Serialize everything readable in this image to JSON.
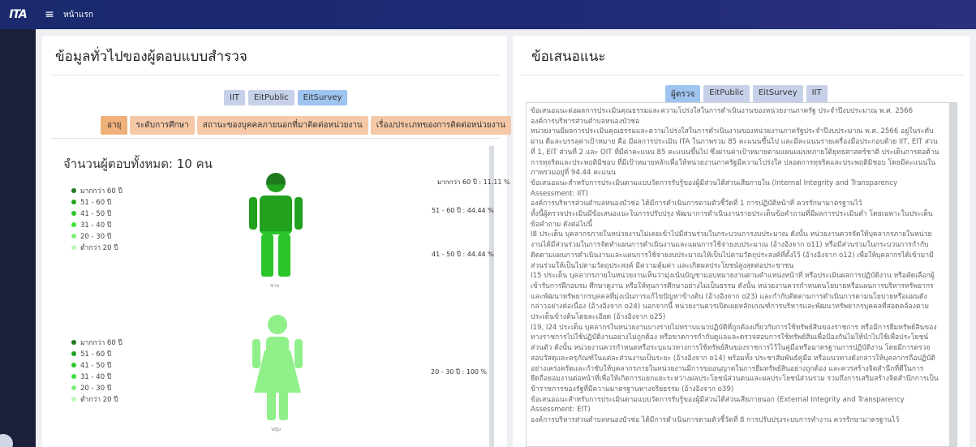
{
  "topbar": {
    "logo": "ITA",
    "menu_icon": "hamburger-icon",
    "breadcrumb": "หน้าแรก"
  },
  "left": {
    "title": "ข้อมูลทั่วไปของผู้ตอบแบบสำรวจ",
    "survey_tabs": [
      "IIT",
      "EitPublic",
      "EitSurvey"
    ],
    "active_survey_tab": "EitSurvey",
    "filter_tabs": [
      "อายุ",
      "ระดับการศึกษา",
      "สถานะของบุคคลภายนอกที่มาติดต่อหน่วยงาน",
      "เรื่อง/ประเภทของการติดต่อหน่วยงาน"
    ],
    "active_filter_tab": "อายุ",
    "total_label": "จำนวนผู้ตอบทั้งหมด: 10 คน",
    "age_legend": [
      "มากกว่า 60 ปี",
      "51 - 60 ปี",
      "41 - 50 ปี",
      "31 - 40 ปี",
      "20 - 30 ปี",
      "ต่ำกว่า 20 ปี"
    ],
    "legend_colors": [
      "#1f7a1f",
      "#22a11e",
      "#2bc52b",
      "#3ee13a",
      "#7ef07a",
      "#bff7bb"
    ],
    "male": {
      "caption": "ชาย",
      "labels": [
        "มากกว่า 60 ปี : 11.11 %",
        "51 - 60 ปี : 44.44 %",
        "41 - 50 ปี : 44.44 %"
      ],
      "shares": [
        11.11,
        44.44,
        44.44
      ]
    },
    "female": {
      "caption": "หญิง",
      "labels": [
        "20 - 30 ปี : 100 %"
      ],
      "shares": [
        100
      ]
    }
  },
  "right": {
    "title": "ข้อเสนอแนะ",
    "tabs": [
      "ผู้ตรวจ",
      "EitPublic",
      "EitSurvey",
      "IIT"
    ],
    "active_tab": "ผู้ตรวจ",
    "paragraphs": [
      "ข้อเสนอแนะต่อผลการประเมินคุณธรรมและความโปร่งใสในการดำเนินงานของหน่วยงานภาครัฐ ประจำปีงบประมาณ พ.ศ. 2566",
      "องค์การบริหารส่วนตำบลหนองบัวช่อ",
      "หน่วยงานมีผลการประเมินคุณธรรมและความโปร่งใสในการดำเนินงานของหน่วยงานภาครัฐประจำปีงบประมาณ พ.ศ. 2566 อยู่ในระดับผ่าน ดีและบรรลุค่าเป้าหมาย คือ มีผลการประเมิน ITA ในภาพรวม 85 คะแนนขึ้นไป และมีคะแนนรายเครื่องมือประกอบด้วย IIT, EIT ส่วนที่ 1, EIT ส่วนที่ 2 และ OIT ที่มีค่าคะแนน 85 คะแนนขึ้นไป ซึ่งผ่านค่าเป้าหมายตามแผนแม่บทภายใต้ยุทธศาสตร์ชาติ ประเด็นการต่อต้านการทุจริตและประพฤติมิชอบ ที่มีเป้าหมายหลักเพื่อให้หน่วยงานภาครัฐมีความโปร่งใส ปลอดการทุจริตและประพฤติมิชอบ โดยมีคะแนนในภาพรวมอยู่ที่ 94.44 คะแนน",
      "ข้อเสนอแนะสำหรับการประเมินตามแบบวัดการรับรู้ของผู้มีส่วนได้ส่วนเสียภายใน (Internal Integrity and Transparency Assessment: IIT)",
      "องค์การบริหารส่วนตำบลหนองบัวช่อ ได้มีการดำเนินการตามตัวชี้วัดที่ 1 การปฏิบัติหน้าที่ ควรรักษามาตรฐานไว้",
      "ทั้งนี้ผู้ตรวจประเมินมีข้อเสนอแนะในการปรับปรุง พัฒนาการดำเนินงานรายประเด็นข้อคำถามที่มีผลการประเมินต่ำ โดยเฉพาะในประเด็นข้อคำถาม ดังต่อไปนี้",
      "I8 ประเด็น บุคลากรภายในหน่วยงานไม่เคยเข้าไปมีส่วนร่วมในกระบวนการงบประมาณ ดังนั้น หน่วยงานควรจัดให้บุคลากรภายในหน่วยงานได้มีส่วนร่วมในการจัดทำแผนการดำเนินงานและแผนการใช้จ่ายงบประมาณ (อ้างอิงจาก o11) หรือมีส่วนร่วมในกระบวนการกำกับติดตามแผนการดำเนินงานและแผนการใช้จ่ายงบประมาณให้เป็นไปตามวัตถุประสงค์ที่ตั้งไว้ (อ้างอิงจาก o12) เพื่อให้บุคลากรได้เข้ามามีส่วนร่วมให้เป็นไปตามวัตถุประสงค์ มีความคุ้มค่า และเกิดผลประโยชน์สูงสุดต่อประชาชน",
      "I15 ประเด็น บุคลากรภายในหน่วยงานเห็นว่ามุ่งเน้นบัญชามอบหมายงานตามตำแหน่งหน้าที่ หรือประเมินผลการปฏิบัติงาน หรือคัดเลือกผู้เข้ารับการฝึกอบรม ศึกษาดูงาน หรือให้ทุนการศึกษาอย่างไม่เป็นธรรม ดังนั้น หน่วยงานควรกำหนดนโยบายหรือแผนการบริหารทรัพยากรและพัฒนาทรัพยากรบุคคลที่มุ่งเน้นการแก้ไขปัญหาข้างต้น (อ้างอิงจาก o23) และกำกับติดตามการดำเนินการตามนโยบายหรือแผนดังกล่าวอย่างต่อเนื่อง (อ้างอิงจาก o24) นอกจากนี้ หน่วยงานควรเปิดเผยหลักเกณฑ์การบริหารและพัฒนาทรัพยากรบุคคลที่สอดคล้องตามประเด็นข้างต้นโดยละเอียด (อ้างอิงจาก o25)",
      "I19, I24 ประเด็น บุคลากรในหน่วยงานบางรายไม่ทราบแนวปฏิบัติที่ถูกต้องเกี่ยวกับการใช้ทรัพย์สินของราชการ หรือมีการยืมทรัพย์สินของทางราชการไปใช้ปฏิบัติงานอย่างไม่ถูกต้อง หรือขาดการกำกับดูแลและตรวจสอบการใช้ทรัพย์สินเพื่อป้องกันไม่ให้นำไปใช้เพื่อประโยชน์ส่วนตัว ดังนั้น หน่วยงานควรกำหนดหรือระบุแนวทางการใช้ทรัพย์สินของราชการไว้ในคู่มือหรือมาตรฐานการปฏิบัติงาน โดยมีการตรวจสอบวัสดุและครุภัณฑ์ในแต่ละส่วนงานเป็นระยะ (อ้างอิงจาก o14) พร้อมทั้ง ประชาสัมพันธ์คู่มือ หรือแนวทางดังกล่าวให้บุคลากรถือปฏิบัติอย่างเคร่งครัดและกำชับให้บุคลากรภายในหน่วยงานมีการขออนุญาตในการยืมทรัพย์สินอย่างถูกต้อง และควรสร้างจิตสำนึกที่ดีในการยึดถือยอมงานต่อหน้าที่เพื่อให้เกิดการแยกแยะระหว่างผลประโยชน์ส่วนตนและผลประโยชน์ส่วนรวม รวมถึงการเสริมสร้างจิตสำนึกการเป็นข้าราชการของรัฐที่มีความมาตรฐานทางจริยธรรม (อ้างอิงจาก o39)",
      "ข้อเสนอแนะสำหรับการประเมินตามแบบวัดการรับรู้ของผู้มีส่วนได้ส่วนเสียภายนอก (External Integrity and Transparency Assessment: EIT)",
      "องค์การบริหารส่วนตำบลหนองบัวช่อ ได้มีการดำเนินการตามตัวชี้วัดที่ 8 การปรับปรุงระบบการทำงาน ควรรักษามาตรฐานไว้"
    ]
  }
}
